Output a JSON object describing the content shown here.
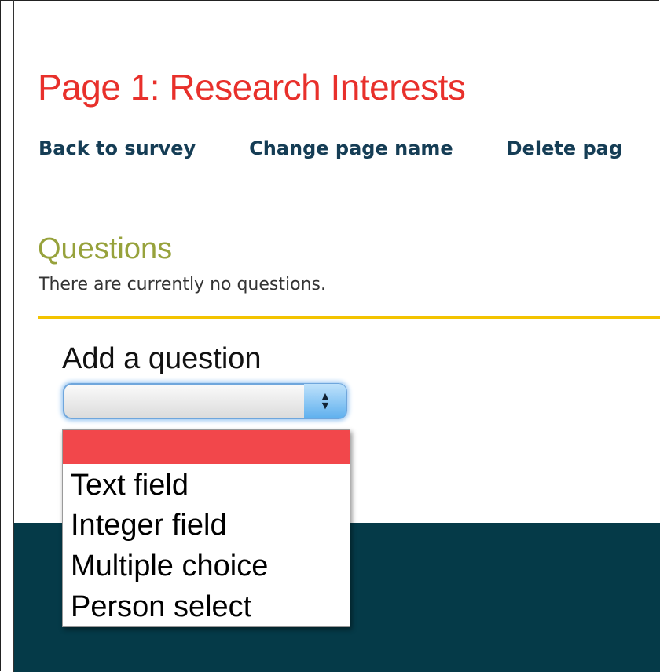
{
  "page": {
    "title": "Page 1: Research Interests"
  },
  "actions": {
    "back": "Back to survey",
    "rename": "Change page name",
    "delete": "Delete pag"
  },
  "questions": {
    "heading": "Questions",
    "empty_message": "There are currently no questions."
  },
  "add_question": {
    "label": "Add a question",
    "selected_value": "",
    "options": [
      "",
      "Text field",
      "Integer field",
      "Multiple choice",
      "Person select"
    ],
    "highlight_color": "#f2474b"
  },
  "colors": {
    "title": "#e8302b",
    "links": "#153d55",
    "section_heading": "#97a23c",
    "rule": "#f3c300",
    "footer_panel": "#053a48"
  },
  "icons": {
    "select_arrows": "up-down-chevron-icon"
  }
}
